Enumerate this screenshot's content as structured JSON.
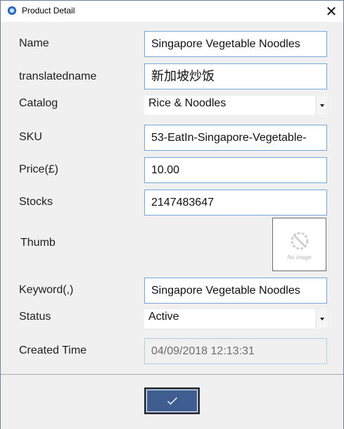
{
  "window": {
    "title": "Product Detail"
  },
  "form": {
    "name": {
      "label": "Name",
      "value": "Singapore Vegetable Noodles"
    },
    "translatedname": {
      "label": "translatedname",
      "value": "新加坡炒饭"
    },
    "catalog": {
      "label": "Catalog",
      "value": "Rice & Noodles"
    },
    "sku": {
      "label": "SKU",
      "value": "53-EatIn-Singapore-Vegetable-"
    },
    "price": {
      "label": "Price(£)",
      "value": "10.00"
    },
    "stocks": {
      "label": "Stocks",
      "value": "2147483647"
    },
    "thumb": {
      "label": "Thumb",
      "placeholder_text": "No image"
    },
    "keyword": {
      "label": "Keyword(,)",
      "value": "Singapore Vegetable Noodles"
    },
    "status": {
      "label": "Status",
      "value": "Active"
    },
    "created_time": {
      "label": "Created Time",
      "value": "04/09/2018 12:13:31"
    }
  },
  "icons": {
    "app": "app-icon",
    "close": "close-icon",
    "confirm": "checkmark-icon",
    "no_image": "no-image-icon",
    "dropdown": "chevron-down-icon"
  },
  "colors": {
    "accent": "#3f5d91",
    "field_border": "#7aa7d8",
    "panel_background": "#f0f0f0"
  }
}
